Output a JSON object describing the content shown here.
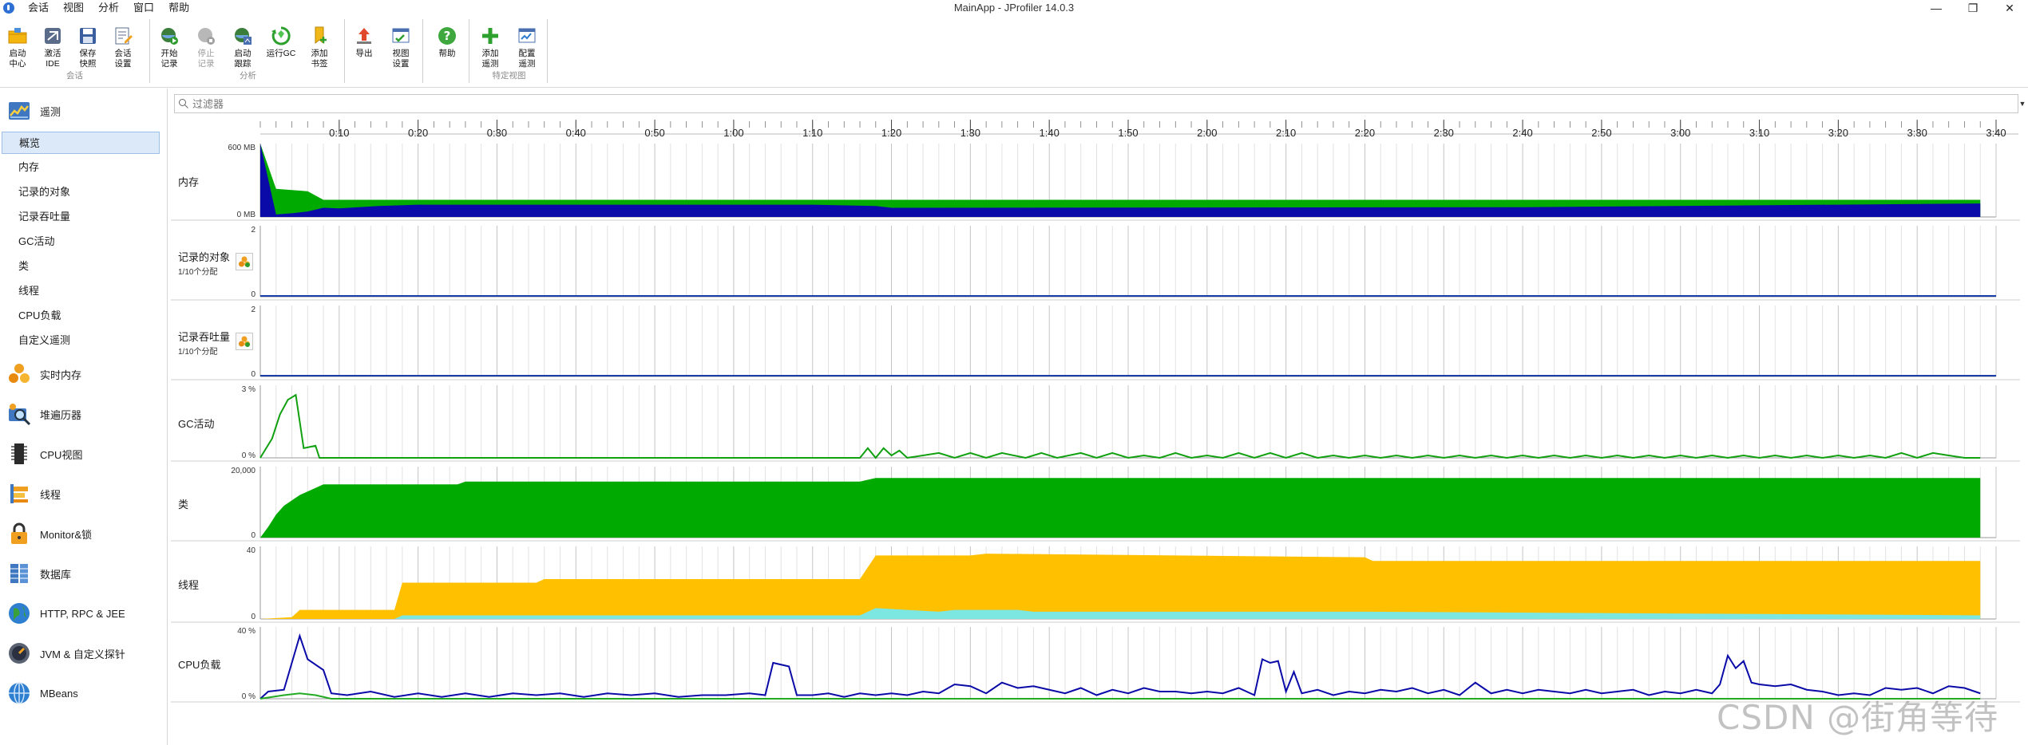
{
  "window": {
    "title": "MainApp - JProfiler 14.0.3",
    "controls": {
      "minimize": "—",
      "restore": "❐",
      "close": "✕"
    }
  },
  "menu": [
    "会话",
    "视图",
    "分析",
    "窗口",
    "帮助"
  ],
  "toolbar": {
    "groups": [
      {
        "label": "会话",
        "buttons": [
          {
            "icon": "start-center-icon",
            "label": "启动\n中心",
            "enabled": true
          },
          {
            "icon": "ide-icon",
            "label": "激活\nIDE",
            "enabled": true
          },
          {
            "icon": "save-snapshot-icon",
            "label": "保存\n快照",
            "enabled": true
          },
          {
            "icon": "session-settings-icon",
            "label": "会话\n设置",
            "enabled": true
          }
        ]
      },
      {
        "label": "分析",
        "buttons": [
          {
            "icon": "start-recording-icon",
            "label": "开始\n记录",
            "enabled": true
          },
          {
            "icon": "stop-recording-icon",
            "label": "停止\n记录",
            "enabled": false
          },
          {
            "icon": "start-tracking-icon",
            "label": "启动\n跟踪",
            "enabled": true
          },
          {
            "icon": "run-gc-icon",
            "label": "运行GC",
            "enabled": true
          },
          {
            "icon": "add-bookmark-icon",
            "label": "添加\n书签",
            "enabled": true
          }
        ]
      },
      {
        "label": "",
        "buttons": [
          {
            "icon": "export-icon",
            "label": "导出",
            "enabled": true
          },
          {
            "icon": "view-settings-icon",
            "label": "视图\n设置",
            "enabled": true
          }
        ]
      },
      {
        "label": "",
        "buttons": [
          {
            "icon": "help-icon",
            "label": "帮助",
            "enabled": true
          }
        ]
      },
      {
        "label": "特定视图",
        "buttons": [
          {
            "icon": "add-telemetry-icon",
            "label": "添加\n遥测",
            "enabled": true
          },
          {
            "icon": "configure-telemetry-icon",
            "label": "配置\n遥测",
            "enabled": true
          }
        ]
      }
    ]
  },
  "sidebar": {
    "telemetry_section": "遥测",
    "telemetry_items": [
      "概览",
      "内存",
      "记录的对象",
      "记录吞吐量",
      "GC活动",
      "类",
      "线程",
      "CPU负载",
      "自定义遥测"
    ],
    "selected_item": "概览",
    "sections": [
      {
        "icon": "live-memory-icon",
        "label": "实时内存"
      },
      {
        "icon": "heap-walker-icon",
        "label": "堆遍历器"
      },
      {
        "icon": "cpu-views-icon",
        "label": "CPU视图"
      },
      {
        "icon": "threads-icon",
        "label": "线程"
      },
      {
        "icon": "monitor-lock-icon",
        "label": "Monitor&锁"
      },
      {
        "icon": "database-icon",
        "label": "数据库"
      },
      {
        "icon": "http-rpc-jee-icon",
        "label": "HTTP, RPC & JEE"
      },
      {
        "icon": "jvm-probe-icon",
        "label": "JVM & 自定义探针"
      },
      {
        "icon": "mbeans-icon",
        "label": "MBeans"
      }
    ]
  },
  "filter": {
    "placeholder": "过滤器"
  },
  "timeline": {
    "ticks": [
      "0:10",
      "0:20",
      "0:30",
      "0:40",
      "0:50",
      "1:00",
      "1:10",
      "1:20",
      "1:30",
      "1:40",
      "1:50",
      "2:00",
      "2:10",
      "2:20",
      "2:30",
      "2:40",
      "2:50",
      "3:00",
      "3:10",
      "3:20",
      "3:30",
      "3:40"
    ]
  },
  "telemetries": [
    {
      "key": "memory",
      "label": "内存",
      "sub": "",
      "ymax": "600 MB",
      "ymin": "0 MB",
      "has_record_button": false
    },
    {
      "key": "recorded_objects",
      "label": "记录的对象",
      "sub": "1/10个分配",
      "ymax": "2",
      "ymin": "0",
      "has_record_button": true
    },
    {
      "key": "recorded_throughput",
      "label": "记录吞吐量",
      "sub": "1/10个分配",
      "ymax": "2",
      "ymin": "0",
      "has_record_button": true
    },
    {
      "key": "gc",
      "label": "GC活动",
      "sub": "",
      "ymax": "3 %",
      "ymin": "0 %",
      "has_record_button": false
    },
    {
      "key": "classes",
      "label": "类",
      "sub": "",
      "ymax": "20,000",
      "ymin": "0",
      "has_record_button": false
    },
    {
      "key": "threads",
      "label": "线程",
      "sub": "",
      "ymax": "40",
      "ymin": "0",
      "has_record_button": false
    },
    {
      "key": "cpu",
      "label": "CPU负载",
      "sub": "",
      "ymax": "40 %",
      "ymin": "0 %",
      "has_record_button": false
    }
  ],
  "chart_data": [
    {
      "type": "area",
      "title": "内存",
      "x_unit": "seconds",
      "ylim": [
        0,
        600
      ],
      "y_unit": "MB",
      "series": [
        {
          "color": "#00aa00",
          "x": [
            0,
            2,
            4,
            6,
            8,
            10,
            15,
            20,
            70,
            78,
            80,
            160,
            218
          ],
          "values": [
            600,
            230,
            220,
            210,
            140,
            140,
            140,
            140,
            140,
            140,
            140,
            140,
            140
          ]
        },
        {
          "color": "#0a0aa8",
          "x": [
            0,
            2,
            4,
            6,
            8,
            10,
            15,
            20,
            70,
            78,
            80,
            160,
            218
          ],
          "values": [
            600,
            20,
            30,
            45,
            75,
            70,
            90,
            100,
            100,
            90,
            75,
            80,
            110
          ]
        }
      ]
    },
    {
      "type": "line",
      "title": "GC活动",
      "x_unit": "seconds",
      "ylim": [
        0,
        3
      ],
      "y_unit": "%",
      "series": [
        {
          "color": "#10a010",
          "x": [
            0,
            1.5,
            2.5,
            3.5,
            4.5,
            5.5,
            7,
            7.5,
            76,
            77,
            78,
            79,
            80,
            81,
            82,
            86,
            88,
            90,
            92,
            94,
            97,
            99,
            101,
            104,
            106,
            108,
            110,
            112,
            114,
            116,
            118,
            120,
            122,
            124,
            126,
            128,
            130,
            132,
            134,
            136,
            138,
            140,
            142,
            144,
            146,
            148,
            150,
            152,
            154,
            156,
            158,
            160,
            162,
            164,
            166,
            168,
            170,
            172,
            174,
            176,
            178,
            180,
            182,
            184,
            186,
            188,
            190,
            192,
            194,
            196,
            198,
            200,
            202,
            204,
            206,
            208,
            210,
            212,
            214,
            216,
            218
          ],
          "values": [
            0,
            0.8,
            1.8,
            2.4,
            2.6,
            0.4,
            0.5,
            0,
            0,
            0.4,
            0,
            0.4,
            0.1,
            0.3,
            0,
            0.2,
            0,
            0.2,
            0,
            0.2,
            0,
            0.2,
            0,
            0.2,
            0,
            0.2,
            0,
            0.1,
            0,
            0.2,
            0,
            0.1,
            0,
            0.2,
            0,
            0.2,
            0,
            0.2,
            0,
            0.1,
            0,
            0.1,
            0,
            0.1,
            0,
            0.1,
            0,
            0.1,
            0,
            0.1,
            0,
            0.1,
            0,
            0.1,
            0,
            0.1,
            0,
            0.1,
            0,
            0.1,
            0,
            0.1,
            0,
            0.1,
            0,
            0.1,
            0,
            0.1,
            0,
            0.1,
            0,
            0.1,
            0,
            0.1,
            0,
            0.2,
            0,
            0.2,
            0.1,
            0,
            0
          ]
        }
      ]
    },
    {
      "type": "area",
      "title": "类",
      "x_unit": "seconds",
      "ylim": [
        0,
        20000
      ],
      "series": [
        {
          "color": "#00aa00",
          "x": [
            0,
            1,
            2,
            3,
            5,
            8,
            25,
            26,
            76,
            78,
            218
          ],
          "values": [
            0,
            3000,
            6500,
            9000,
            12000,
            15000,
            15000,
            15800,
            15800,
            16800,
            16800
          ]
        }
      ]
    },
    {
      "type": "area",
      "title": "线程",
      "x_unit": "seconds",
      "ylim": [
        0,
        40
      ],
      "series": [
        {
          "color": "#ffc000",
          "x": [
            0,
            4,
            5,
            17,
            18,
            35,
            36,
            76,
            78,
            90,
            92,
            140,
            141,
            218
          ],
          "values": [
            0,
            1,
            5,
            5,
            20,
            20,
            22,
            22,
            35,
            35,
            36,
            34,
            32,
            32
          ]
        },
        {
          "color": "#7ce6e0",
          "x": [
            0,
            17,
            18,
            76,
            78,
            82,
            86,
            88,
            96,
            98,
            140,
            218
          ],
          "values": [
            0,
            0,
            2,
            2,
            6,
            5,
            4,
            5,
            5,
            4,
            4,
            2
          ]
        }
      ]
    },
    {
      "type": "line",
      "title": "CPU负载",
      "x_unit": "seconds",
      "ylim": [
        0,
        40
      ],
      "series": [
        {
          "color": "#0a0aa8",
          "x": [
            0,
            1,
            3,
            5,
            6,
            8,
            9,
            11,
            14,
            17,
            20,
            23,
            26,
            29,
            32,
            35,
            38,
            41,
            44,
            47,
            50,
            53,
            56,
            59,
            62,
            64,
            65,
            67,
            68,
            70,
            72,
            74,
            76,
            78,
            80,
            82,
            84,
            86,
            88,
            90,
            92,
            94,
            96,
            98,
            100,
            102,
            104,
            106,
            108,
            110,
            112,
            114,
            116,
            118,
            120,
            122,
            124,
            126,
            127,
            128,
            129,
            130,
            131,
            132,
            134,
            136,
            138,
            140,
            142,
            144,
            146,
            148,
            150,
            152,
            154,
            156,
            158,
            160,
            162,
            164,
            166,
            168,
            170,
            172,
            174,
            176,
            178,
            180,
            182,
            184,
            185,
            186,
            187,
            188,
            189,
            190,
            192,
            194,
            196,
            198,
            200,
            202,
            204,
            206,
            208,
            210,
            212,
            214,
            216,
            218
          ],
          "values": [
            0,
            4,
            5,
            35,
            22,
            16,
            3,
            2,
            4,
            1,
            3,
            1,
            3,
            1,
            3,
            2,
            3,
            1,
            3,
            2,
            3,
            1,
            2,
            2,
            3,
            2,
            20,
            18,
            2,
            2,
            3,
            1,
            3,
            2,
            3,
            2,
            4,
            3,
            8,
            7,
            3,
            9,
            6,
            7,
            5,
            3,
            6,
            2,
            5,
            3,
            6,
            4,
            4,
            3,
            4,
            3,
            6,
            2,
            22,
            20,
            21,
            4,
            15,
            3,
            5,
            2,
            4,
            3,
            5,
            4,
            6,
            3,
            5,
            2,
            9,
            3,
            5,
            3,
            5,
            4,
            3,
            5,
            3,
            4,
            5,
            2,
            4,
            3,
            5,
            3,
            8,
            24,
            17,
            21,
            9,
            8,
            7,
            8,
            5,
            4,
            2,
            3,
            2,
            6,
            5,
            6,
            3,
            7,
            6,
            3
          ]
        },
        {
          "color": "#22aa22",
          "x": [
            0,
            3,
            5,
            7,
            9,
            218
          ],
          "values": [
            0,
            2,
            3,
            2,
            0,
            0
          ]
        }
      ]
    }
  ],
  "watermark": "CSDN @街角等待"
}
